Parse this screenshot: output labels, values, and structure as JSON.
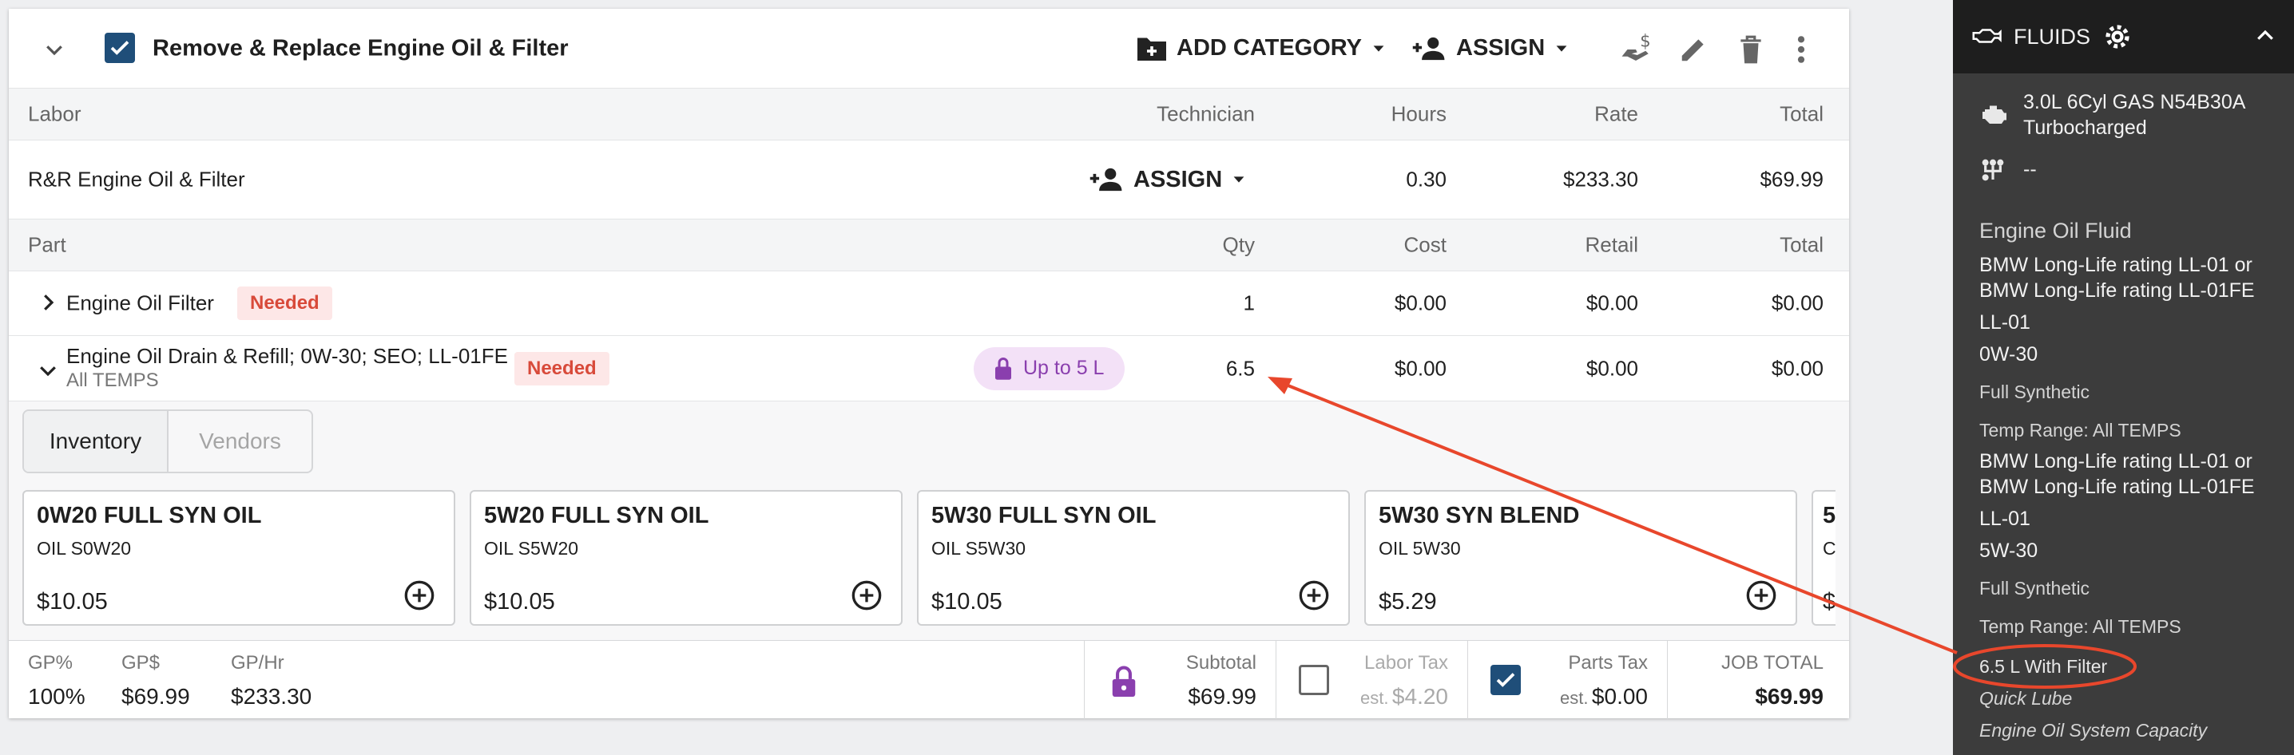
{
  "job": {
    "title": "Remove & Replace Engine Oil & Filter",
    "add_category_label": "ADD CATEGORY",
    "assign_label": "ASSIGN"
  },
  "labor": {
    "headers": {
      "labor": "Labor",
      "technician": "Technician",
      "hours": "Hours",
      "rate": "Rate",
      "total": "Total"
    },
    "row": {
      "name": "R&R Engine Oil & Filter",
      "assign_label": "ASSIGN",
      "hours": "0.30",
      "rate": "$233.30",
      "total": "$69.99"
    }
  },
  "parts": {
    "headers": {
      "part": "Part",
      "qty": "Qty",
      "cost": "Cost",
      "retail": "Retail",
      "total": "Total"
    },
    "rows": [
      {
        "name": "Engine Oil Filter",
        "sub": "",
        "badge": "Needed",
        "qty": "1",
        "cost": "$0.00",
        "retail": "$0.00",
        "total": "$0.00"
      },
      {
        "name": "Engine Oil Drain & Refill; 0W-30; SEO; LL-01FE",
        "sub": "All TEMPS",
        "badge": "Needed",
        "chip": "Up to 5 L",
        "qty": "6.5",
        "cost": "$0.00",
        "retail": "$0.00",
        "total": "$0.00"
      }
    ]
  },
  "tabs": {
    "inventory": "Inventory",
    "vendors": "Vendors"
  },
  "products": [
    {
      "name": "0W20 FULL SYN OIL",
      "code": "OIL S0W20",
      "price": "$10.05"
    },
    {
      "name": "5W20 FULL SYN OIL",
      "code": "OIL S5W20",
      "price": "$10.05"
    },
    {
      "name": "5W30 FULL SYN OIL",
      "code": "OIL S5W30",
      "price": "$10.05"
    },
    {
      "name": "5W30 SYN BLEND",
      "code": "OIL 5W30",
      "price": "$5.29"
    },
    {
      "name": "5",
      "code": "C",
      "price": "$"
    }
  ],
  "footer": {
    "gp_pct_label": "GP%",
    "gp_pct": "100%",
    "gp_dollar_label": "GP$",
    "gp_dollar": "$69.99",
    "gp_hr_label": "GP/Hr",
    "gp_hr": "$233.30",
    "subtotal_label": "Subtotal",
    "subtotal": "$69.99",
    "labor_tax_label": "Labor Tax",
    "labor_tax_est": "est.",
    "labor_tax": "$4.20",
    "parts_tax_label": "Parts Tax",
    "parts_tax_est": "est.",
    "parts_tax": "$0.00",
    "job_total_label": "JOB TOTAL",
    "job_total": "$69.99"
  },
  "sidebar": {
    "title": "FLUIDS",
    "engine_line1": "3.0L 6Cyl GAS N54B30A",
    "engine_line2": "Turbocharged",
    "drivetrain": "--",
    "section_title": "Engine Oil Fluid",
    "spec1_line1": "BMW Long-Life rating LL-01 or",
    "spec1_line2": "BMW Long-Life rating LL-01FE",
    "spec1_line3": "LL-01",
    "spec1_viscosity": "0W-30",
    "spec1_type": "Full Synthetic",
    "spec1_temp": "Temp Range: All TEMPS",
    "spec2_line1": "BMW Long-Life rating LL-01 or",
    "spec2_line2": "BMW Long-Life rating LL-01FE",
    "spec2_line3": "LL-01",
    "spec2_viscosity": "5W-30",
    "spec2_type": "Full Synthetic",
    "spec2_temp": "Temp Range: All TEMPS",
    "capacity": "6.5 L With Filter",
    "quick_lube": "Quick Lube",
    "system_capacity": "Engine Oil System Capacity"
  },
  "colors": {
    "accent": "#1f4e79",
    "needed_bg": "#fde7e7",
    "needed_text": "#d84a3a",
    "chip_bg": "#f3e1f7",
    "chip_text": "#8a3fae",
    "annotation": "#e8472c"
  }
}
